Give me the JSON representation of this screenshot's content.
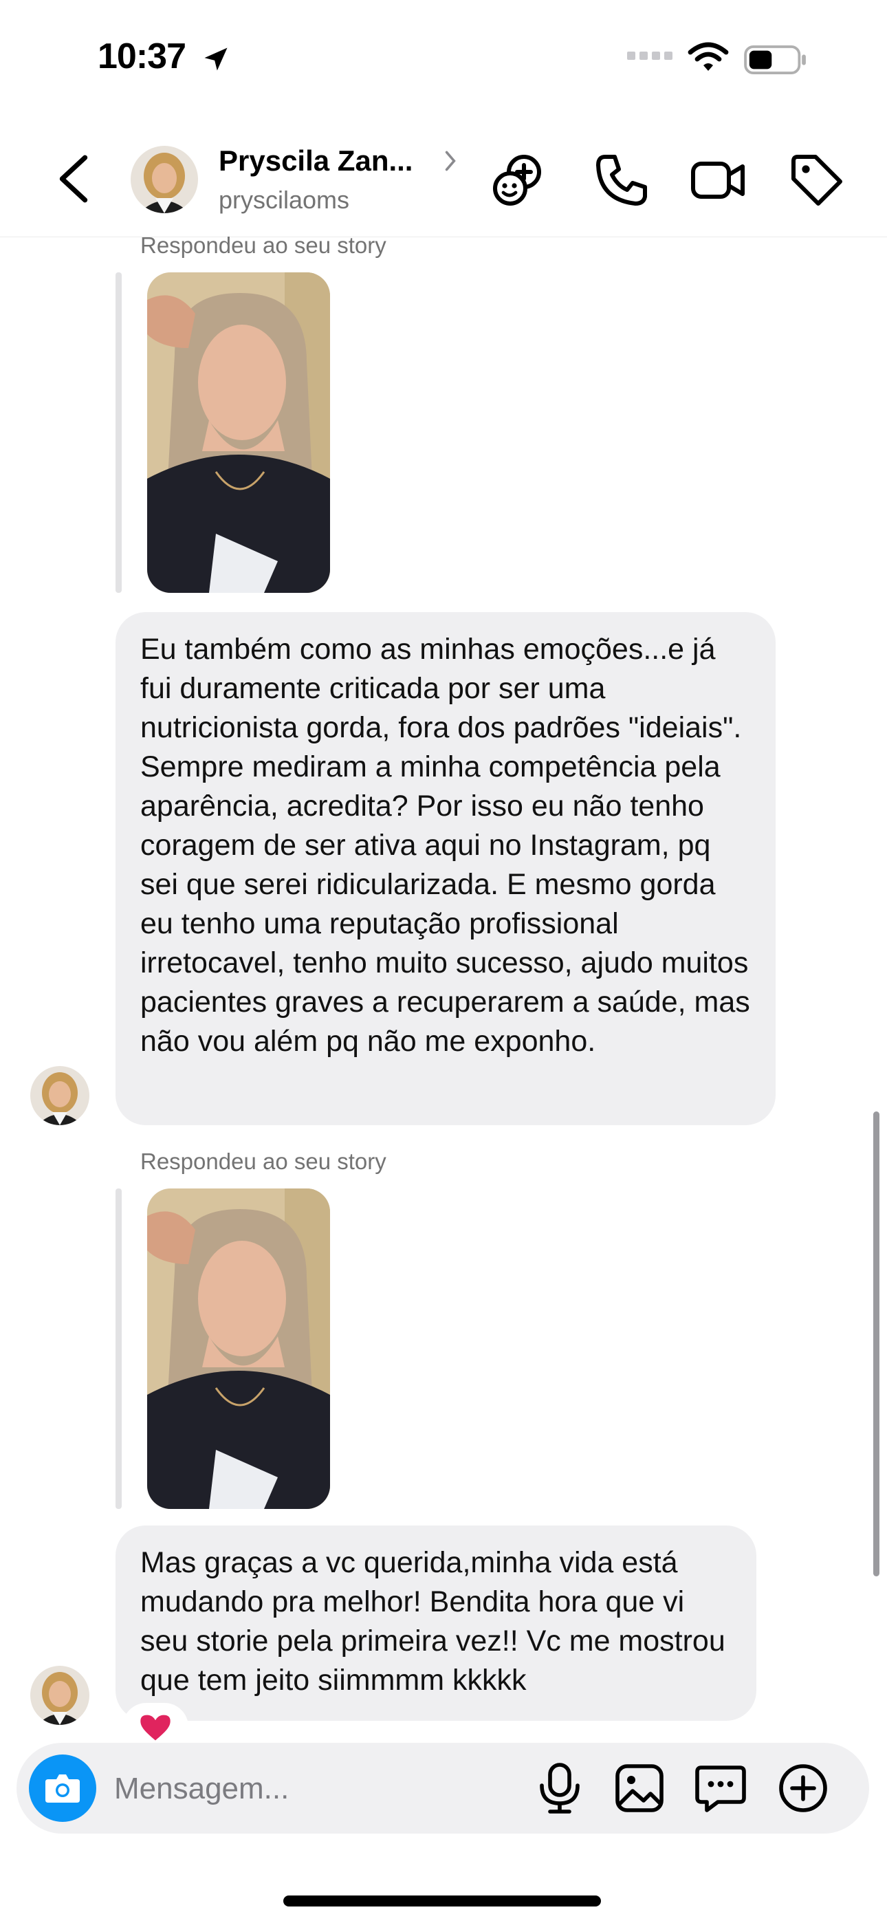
{
  "status_bar": {
    "time": "10:37"
  },
  "header": {
    "contact_name": "Pryscila Zan...",
    "username": "pryscilaoms"
  },
  "messages": [
    {
      "reply_label": "Respondeu ao seu story",
      "text": "Eu também como as minhas emoções...e já fui duramente criticada por ser uma nutricionista gorda, fora dos padrões \"ideiais\". Sempre mediram a minha competência pela aparência, acredita? Por isso eu não tenho coragem de ser ativa aqui no Instagram, pq sei que  serei ridicularizada. E mesmo gorda eu tenho uma reputação profissional irretocavel, tenho muito sucesso, ajudo muitos pacientes graves a recuperarem a saúde, mas não vou além pq não me exponho."
    },
    {
      "reply_label": "Respondeu ao seu story",
      "text": "Mas graças a vc querida,minha vida está mudando pra melhor! Bendita hora que vi seu storie pela primeira vez!! Vc me mostrou que tem jeito siimmmm kkkkk",
      "reaction": "❤️"
    }
  ],
  "composer": {
    "placeholder": "Mensagem..."
  },
  "colors": {
    "accent": "#0a95f6",
    "bubble": "#efeff1",
    "reaction": "#e0245e"
  }
}
